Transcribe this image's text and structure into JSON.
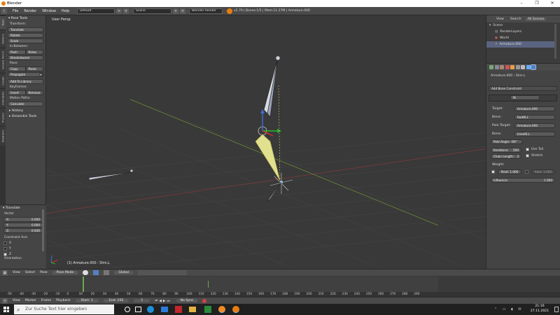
{
  "window": {
    "title": "Blender"
  },
  "topbar": {
    "menus": [
      "File",
      "Render",
      "Window",
      "Help"
    ],
    "layout": "Default",
    "scene": "Scene",
    "engine": "Blender Render",
    "info": "v2.79 | Bones:1/5 | Mem:11.27M | Armature.000"
  },
  "left_tabs": [
    "Tools",
    "Options",
    "Grease Pencil",
    "Create",
    "Animation",
    "Physics",
    "Relations"
  ],
  "tools": {
    "title": "Pose Tools",
    "transform": {
      "label": "Transform:",
      "buttons": [
        "Translate",
        "Rotate",
        "Scale"
      ]
    },
    "inbetween": {
      "label": "In-Between:",
      "push": "Push",
      "relax": "Relax",
      "breakdowner": "Breakdowner"
    },
    "pose": {
      "label": "Pose:",
      "copy": "Copy",
      "paste": "Paste",
      "propagate": "Propagate",
      "add_library": "Add To Library"
    },
    "keyframes": {
      "label": "Keyframes:",
      "insert": "Insert",
      "remove": "Remove"
    },
    "motion": {
      "label": "Motion Paths:",
      "calculate": "Calculate"
    },
    "history": "History",
    "onionskin": "Onionskin Tools"
  },
  "operator": {
    "title": "Translate",
    "vector_label": "Vector",
    "x": {
      "label": "X:",
      "value": "0.000"
    },
    "y": {
      "label": "Y:",
      "value": "0.000"
    },
    "z": {
      "label": "Z:",
      "value": "0.640"
    },
    "constraint_label": "Constraint Axis",
    "axes": [
      {
        "label": "X",
        "checked": false
      },
      {
        "label": "Y",
        "checked": false
      },
      {
        "label": "Z",
        "checked": true
      }
    ],
    "orientation_label": "Orientation"
  },
  "viewport": {
    "view_label": "User Persp",
    "status": "(1) Armature.000 : Shin.L"
  },
  "outliner": {
    "tabs": [
      "View",
      "Search",
      "All Scenes"
    ],
    "items": [
      "Scene",
      "RenderLayers",
      "World",
      "Armature.000"
    ]
  },
  "properties": {
    "breadcrumb_obj": "Armature.000",
    "breadcrumb_bone": "Shin.L",
    "add_constraint": "Add Bone Constraint",
    "ik_name": "IK",
    "target_label": "Target:",
    "target": "Armature.000",
    "bone_label": "Bone:",
    "bone": "footIK.L",
    "pole_target_label": "Pole Target:",
    "pole_target": "Armature.000",
    "bone2_label": "Bone:",
    "bone2": "kneeIK.L",
    "pole_angle": "Pole Angle: -90°",
    "iterations": "Iterations:",
    "iterations_value": "500",
    "use_tail": "Use Tail",
    "chain_length": "Chain Length:",
    "chain_value": "3",
    "stretch": "Stretch",
    "weight_label": "Weight:",
    "position": "Posit: 1.000",
    "rotation": "Rota: 1.000",
    "influence": "Influence:",
    "influence_value": "1.000"
  },
  "view_header": {
    "items": [
      "View",
      "Select",
      "Pose"
    ],
    "mode": "Pose Mode",
    "orientation": "Global"
  },
  "timeline": {
    "ticks": [
      "-50",
      "-40",
      "-30",
      "-20",
      "-10",
      "0",
      "10",
      "20",
      "30",
      "40",
      "50",
      "60",
      "70",
      "80",
      "90",
      "100",
      "110",
      "120",
      "130",
      "140",
      "150",
      "160",
      "170",
      "180",
      "190",
      "200",
      "210",
      "220",
      "230",
      "240",
      "250",
      "260",
      "270",
      "280",
      "290"
    ]
  },
  "timeline_header": {
    "items": [
      "View",
      "Marker",
      "Frame",
      "Playback"
    ],
    "start": "Start:",
    "start_value": "1",
    "end": "End:",
    "end_value": "250",
    "current": "1",
    "sync": "No Sync"
  },
  "taskbar": {
    "search_placeholder": "Zur Suche Text hier eingeben",
    "time": "21:16",
    "date": "27.11.2021"
  },
  "colors": {
    "accent": "#5680c2",
    "selected_bone": "#d9d98a",
    "timeline_cursor": "#6aa84f",
    "firefox": "#f08a24",
    "blender": "#e87d0d"
  }
}
